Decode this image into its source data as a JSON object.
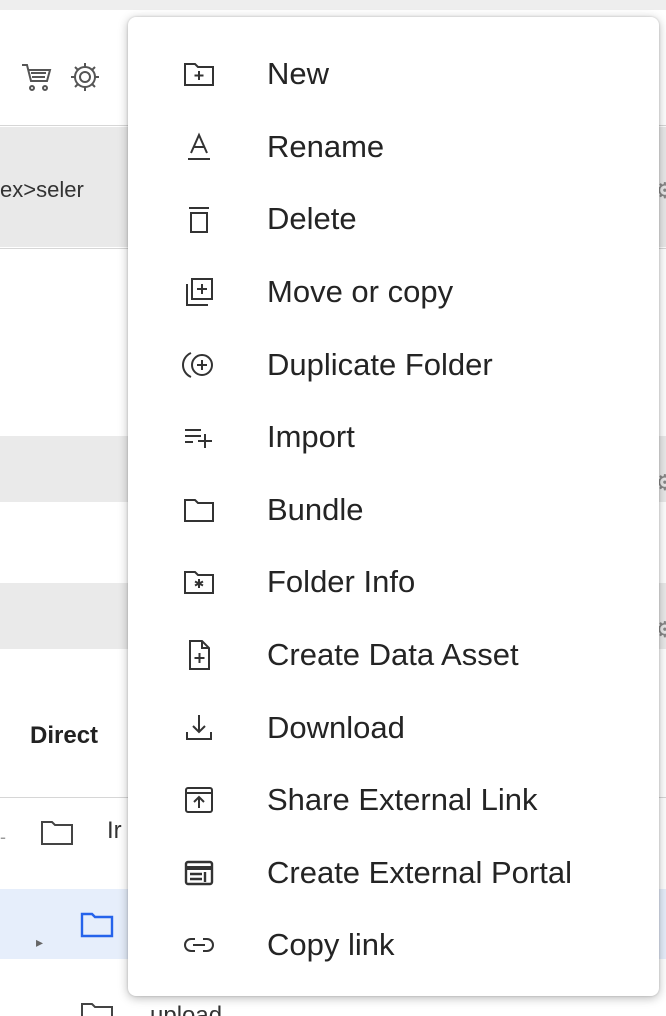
{
  "background": {
    "breadcrumb_fragment": "ex>seler",
    "section_title_fragment": "Direct",
    "tree": [
      {
        "label_fragment": "Ir",
        "selected": false,
        "icon": "folder-icon"
      },
      {
        "label_fragment": "",
        "selected": true,
        "icon": "folder-icon",
        "expandable": true
      },
      {
        "label_fragment": "upload",
        "selected": false,
        "icon": "folder-icon"
      }
    ],
    "toolbar_icons": [
      "cart-icon",
      "gear-icon"
    ]
  },
  "context_menu": {
    "items": [
      {
        "label": "New",
        "icon": "new-folder-icon"
      },
      {
        "label": "Rename",
        "icon": "rename-icon"
      },
      {
        "label": "Delete",
        "icon": "trash-icon"
      },
      {
        "label": "Move or copy",
        "icon": "move-copy-icon"
      },
      {
        "label": "Duplicate Folder",
        "icon": "duplicate-icon"
      },
      {
        "label": "Import",
        "icon": "import-icon"
      },
      {
        "label": "Bundle",
        "icon": "folder-icon"
      },
      {
        "label": "Folder Info",
        "icon": "folder-info-icon"
      },
      {
        "label": "Create Data Asset",
        "icon": "create-data-asset-icon"
      },
      {
        "label": "Download",
        "icon": "download-icon"
      },
      {
        "label": "Share External Link",
        "icon": "share-link-icon"
      },
      {
        "label": "Create External Portal",
        "icon": "portal-icon"
      },
      {
        "label": "Copy link",
        "icon": "link-icon"
      }
    ]
  },
  "colors": {
    "text": "#242424",
    "icon": "#333333",
    "selected_row": "#e6eefb",
    "folder_selected": "#2563eb",
    "background_band": "#eaeaea"
  }
}
